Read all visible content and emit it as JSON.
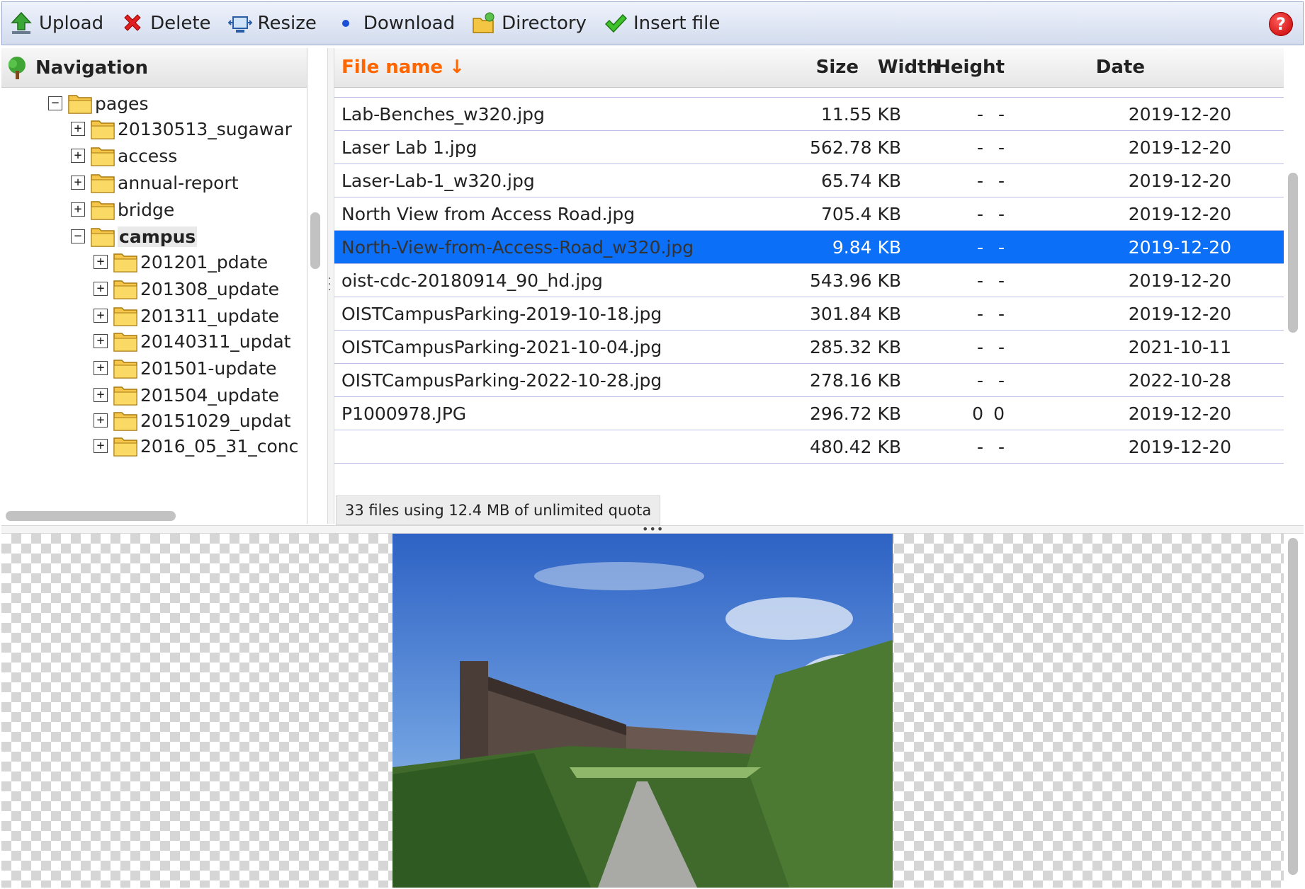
{
  "toolbar": {
    "upload": "Upload",
    "delete": "Delete",
    "resize": "Resize",
    "download": "Download",
    "directory": "Directory",
    "insert_file": "Insert file",
    "help": "?"
  },
  "nav": {
    "title": "Navigation",
    "tree": [
      {
        "label": "pages",
        "toggle": "−",
        "bold": false
      },
      {
        "label": "20130513_sugawar",
        "toggle": "+",
        "bold": false
      },
      {
        "label": "access",
        "toggle": "+",
        "bold": false
      },
      {
        "label": "annual-report",
        "toggle": "+",
        "bold": false
      },
      {
        "label": "bridge",
        "toggle": "+",
        "bold": false
      },
      {
        "label": "campus",
        "toggle": "−",
        "bold": true
      },
      {
        "label": "201201_pdate",
        "toggle": "+",
        "bold": false
      },
      {
        "label": "201308_update",
        "toggle": "+",
        "bold": false
      },
      {
        "label": "201311_update",
        "toggle": "+",
        "bold": false
      },
      {
        "label": "20140311_updat",
        "toggle": "+",
        "bold": false
      },
      {
        "label": "201501-update",
        "toggle": "+",
        "bold": false
      },
      {
        "label": "201504_update",
        "toggle": "+",
        "bold": false
      },
      {
        "label": "20151029_updat",
        "toggle": "+",
        "bold": false
      },
      {
        "label": "2016_05_31_conc",
        "toggle": "+",
        "bold": false
      }
    ]
  },
  "files": {
    "columns": {
      "name": "File name ↓",
      "size": "Size",
      "width": "Width",
      "height": "Height",
      "date": "Date"
    },
    "rows": [
      {
        "name": "Lab-Benches_w320.jpg",
        "size": "11.55 KB",
        "width": "-",
        "height": "-",
        "date": "2019-12-20",
        "selected": false
      },
      {
        "name": "Laser Lab 1.jpg",
        "size": "562.78 KB",
        "width": "-",
        "height": "-",
        "date": "2019-12-20",
        "selected": false
      },
      {
        "name": "Laser-Lab-1_w320.jpg",
        "size": "65.74 KB",
        "width": "-",
        "height": "-",
        "date": "2019-12-20",
        "selected": false
      },
      {
        "name": "North View from Access Road.jpg",
        "size": "705.4 KB",
        "width": "-",
        "height": "-",
        "date": "2019-12-20",
        "selected": false
      },
      {
        "name": "North-View-from-Access-Road_w320.jpg",
        "size": "9.84 KB",
        "width": "-",
        "height": "-",
        "date": "2019-12-20",
        "selected": true
      },
      {
        "name": "oist-cdc-20180914_90_hd.jpg",
        "size": "543.96 KB",
        "width": "-",
        "height": "-",
        "date": "2019-12-20",
        "selected": false
      },
      {
        "name": "OISTCampusParking-2019-10-18.jpg",
        "size": "301.84 KB",
        "width": "-",
        "height": "-",
        "date": "2019-12-20",
        "selected": false
      },
      {
        "name": "OISTCampusParking-2021-10-04.jpg",
        "size": "285.32 KB",
        "width": "-",
        "height": "-",
        "date": "2021-10-11",
        "selected": false
      },
      {
        "name": "OISTCampusParking-2022-10-28.jpg",
        "size": "278.16 KB",
        "width": "-",
        "height": "-",
        "date": "2022-10-28",
        "selected": false
      },
      {
        "name": "P1000978.JPG",
        "size": "296.72 KB",
        "width": "0",
        "height": "0",
        "date": "2019-12-20",
        "selected": false
      },
      {
        "name": "",
        "size": "480.42 KB",
        "width": "-",
        "height": "-",
        "date": "2019-12-20",
        "selected": false
      }
    ],
    "status": "33 files using 12.4 MB of unlimited quota"
  },
  "colors": {
    "selected_row": "#0b6ff7",
    "sort_column": "#ff6600",
    "row_divider": "#b9bfe6"
  }
}
